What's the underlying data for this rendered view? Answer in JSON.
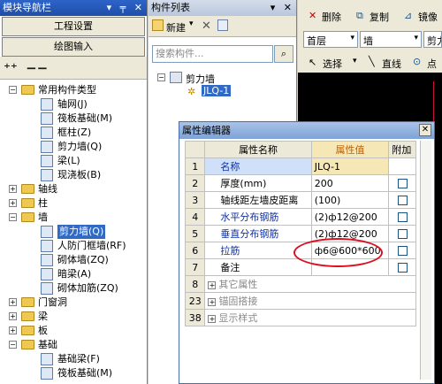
{
  "nav": {
    "title": "模块导航栏",
    "title_buttons": "▾ ╤ ✕",
    "btn_engineering": "工程设置",
    "btn_drawing": "绘图输入",
    "tree": [
      {
        "label": "常用构件类型",
        "level": 0,
        "pm": "−",
        "kind": "folder"
      },
      {
        "label": "轴网(J)",
        "level": 1,
        "kind": "leaf"
      },
      {
        "label": "筏板基础(M)",
        "level": 1,
        "kind": "leaf"
      },
      {
        "label": "框柱(Z)",
        "level": 1,
        "kind": "leaf"
      },
      {
        "label": "剪力墙(Q)",
        "level": 1,
        "kind": "leaf"
      },
      {
        "label": "梁(L)",
        "level": 1,
        "kind": "leaf"
      },
      {
        "label": "现浇板(B)",
        "level": 1,
        "kind": "leaf"
      },
      {
        "label": "轴线",
        "level": 0,
        "pm": "+",
        "kind": "folder"
      },
      {
        "label": "柱",
        "level": 0,
        "pm": "+",
        "kind": "folder"
      },
      {
        "label": "墙",
        "level": 0,
        "pm": "−",
        "kind": "folder"
      },
      {
        "label": "剪力墙(Q)",
        "level": 1,
        "kind": "leaf",
        "selected": true
      },
      {
        "label": "人防门框墙(RF)",
        "level": 1,
        "kind": "leaf"
      },
      {
        "label": "砌体墙(ZQ)",
        "level": 1,
        "kind": "leaf"
      },
      {
        "label": "暗梁(A)",
        "level": 1,
        "kind": "leaf"
      },
      {
        "label": "砌体加筋(ZQ)",
        "level": 1,
        "kind": "leaf"
      },
      {
        "label": "门窗洞",
        "level": 0,
        "pm": "+",
        "kind": "folder"
      },
      {
        "label": "梁",
        "level": 0,
        "pm": "+",
        "kind": "folder"
      },
      {
        "label": "板",
        "level": 0,
        "pm": "+",
        "kind": "folder"
      },
      {
        "label": "基础",
        "level": 0,
        "pm": "−",
        "kind": "folder"
      },
      {
        "label": "基础梁(F)",
        "level": 1,
        "kind": "leaf"
      },
      {
        "label": "筏板基础(M)",
        "level": 1,
        "kind": "leaf"
      }
    ]
  },
  "comp": {
    "title": "构件列表",
    "title_buttons": "▾ ✕",
    "new_label": "新建",
    "search_placeholder": "搜索构件...",
    "root_label": "剪力墙",
    "child_label": "JLQ-1"
  },
  "right": {
    "delete_label": "删除",
    "copy_label": "复制",
    "mirror_label": "镜像",
    "floor_label": "首层",
    "type_label": "墙",
    "extra_label": "剪力",
    "select_label": "选择",
    "line_label": "直线",
    "point_label": "点"
  },
  "prop": {
    "title": "属性编辑器",
    "close": "✕",
    "headers": {
      "name": "属性名称",
      "value": "属性值",
      "extra": "附加"
    },
    "rows": [
      {
        "num": "1",
        "name": "名称",
        "value": "JLQ-1",
        "color": "blue",
        "check": false,
        "sel": true
      },
      {
        "num": "2",
        "name": "厚度(mm)",
        "value": "200",
        "color": "black",
        "check": true
      },
      {
        "num": "3",
        "name": "轴线距左墙皮距离",
        "value": "(100)",
        "color": "black",
        "check": true
      },
      {
        "num": "4",
        "name": "水平分布钢筋",
        "value": "(2)ф12@200",
        "color": "blue",
        "check": true
      },
      {
        "num": "5",
        "name": "垂直分布钢筋",
        "value": "(2)ф12@200",
        "color": "blue",
        "check": true
      },
      {
        "num": "6",
        "name": "拉筋",
        "value": "ф6@600*600",
        "color": "blue",
        "check": true
      },
      {
        "num": "7",
        "name": "备注",
        "value": "",
        "color": "black",
        "check": true
      },
      {
        "num": "8",
        "name": "其它属性",
        "value": "",
        "color": "gray",
        "group": true
      },
      {
        "num": "23",
        "name": "锚固搭接",
        "value": "",
        "color": "gray",
        "group": true
      },
      {
        "num": "38",
        "name": "显示样式",
        "value": "",
        "color": "gray",
        "group": true
      }
    ]
  }
}
